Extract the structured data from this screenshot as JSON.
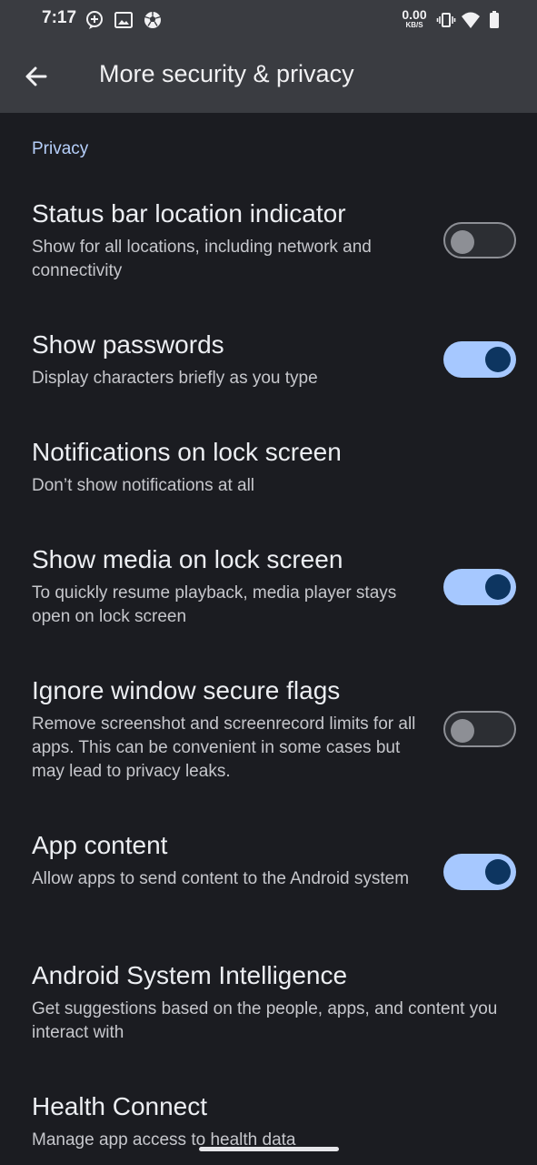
{
  "status_bar": {
    "time": "7:17",
    "net_speed_value": "0.00",
    "net_speed_unit": "KB/S",
    "icons": [
      "assistant-plus-icon",
      "image-icon",
      "soccer-ball-icon",
      "vibrate-icon",
      "wifi-icon",
      "battery-icon"
    ]
  },
  "app_bar": {
    "title": "More security & privacy",
    "back_icon": "arrow-back-icon"
  },
  "section": {
    "header": "Privacy"
  },
  "settings": [
    {
      "title": "Status bar location indicator",
      "subtitle": "Show for all locations, including network and connectivity",
      "toggle": "off"
    },
    {
      "title": "Show passwords",
      "subtitle": "Display characters briefly as you type",
      "toggle": "on"
    },
    {
      "title": "Notifications on lock screen",
      "subtitle": "Don’t show notifications at all",
      "toggle": null
    },
    {
      "title": "Show media on lock screen",
      "subtitle": "To quickly resume playback, media player stays open on lock screen",
      "toggle": "on"
    },
    {
      "title": "Ignore window secure flags",
      "subtitle": "Remove screenshot and screenrecord limits for all apps. This can be convenient in some cases but may lead to privacy leaks.",
      "toggle": "off"
    },
    {
      "title": "App content",
      "subtitle": "Allow apps to send content to the Android system",
      "toggle": "on"
    },
    {
      "title": "Android System Intelligence",
      "subtitle": "Get suggestions based on the people, apps, and content you interact with",
      "toggle": null
    },
    {
      "title": "Health Connect",
      "subtitle": "Manage app access to health data",
      "toggle": null
    }
  ],
  "colors": {
    "background": "#1b1c21",
    "app_bar": "#3a3c41",
    "accent": "#b6cffb",
    "switch_on_track": "#a6c8ff",
    "switch_on_knob": "#0d3560",
    "switch_off": "#8d8f95"
  }
}
